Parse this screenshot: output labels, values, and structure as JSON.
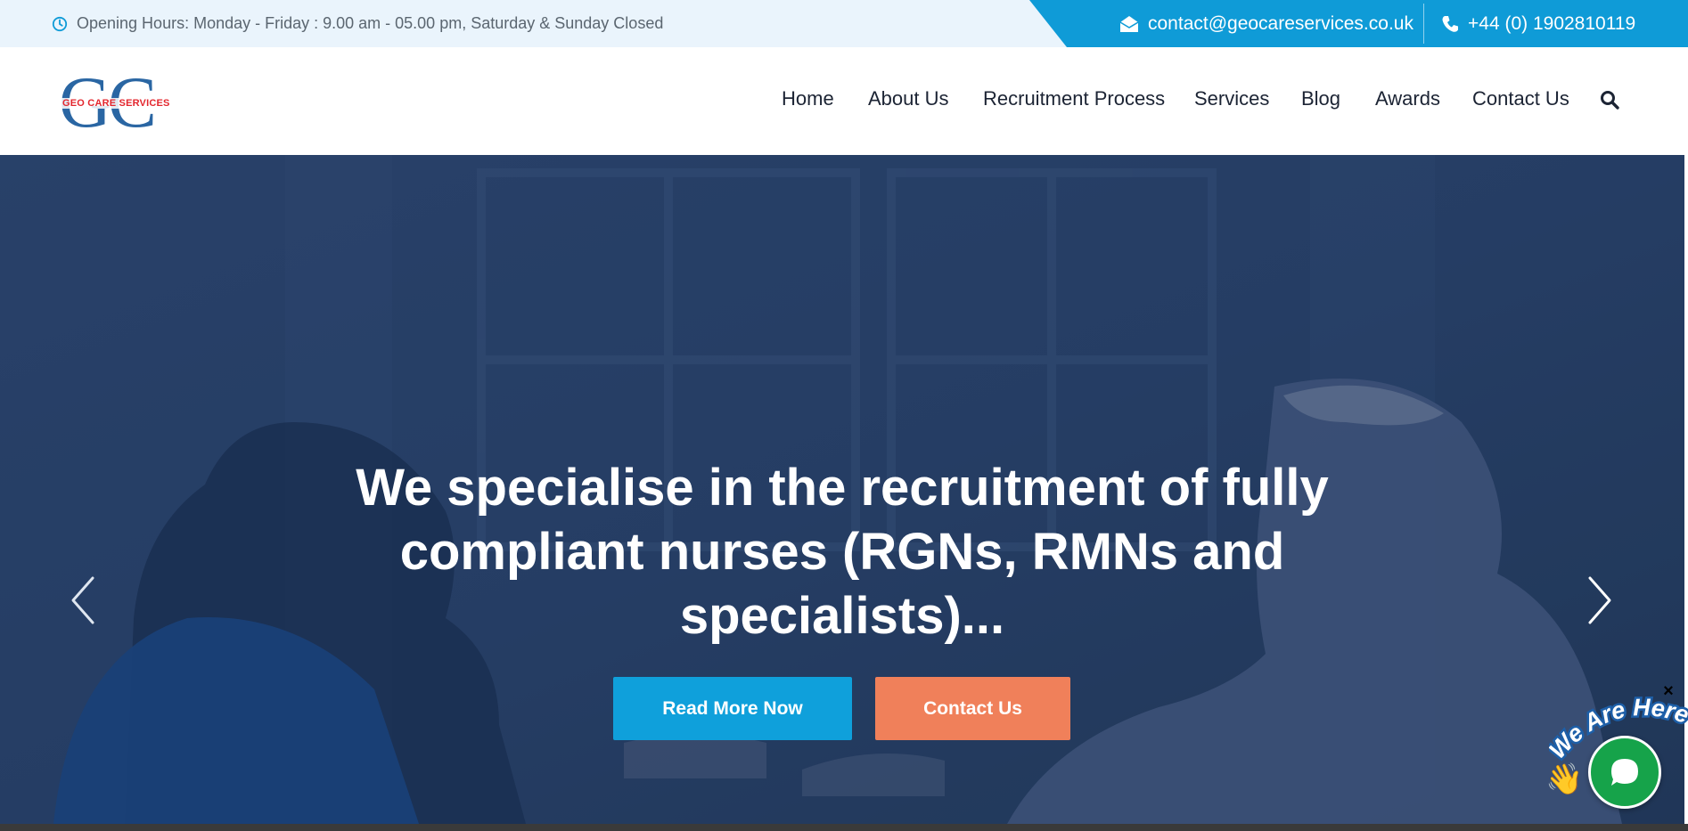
{
  "topbar": {
    "hours": "Opening Hours: Monday - Friday : 9.00 am - 05.00 pm, Saturday & Sunday Closed",
    "email": "contact@geocareservices.co.uk",
    "phone": "+44 (0) 1902810119"
  },
  "logo": {
    "letters": "GC",
    "tagline": "GEO CARE SERVICES"
  },
  "nav": {
    "items": [
      "Home",
      "About Us",
      "Recruitment Process",
      "Services",
      "Blog",
      "Awards",
      "Contact Us"
    ],
    "search_icon": "search-icon"
  },
  "hero": {
    "title": "We specialise in the recruitment of fully compliant nurses (RGNs, RMNs and specialists)...",
    "primary_button": "Read More Now",
    "secondary_button": "Contact Us"
  },
  "chat": {
    "label": "We Are Here!",
    "close": "×"
  },
  "colors": {
    "accent": "#0f9bd7",
    "primary_button": "#0fa0db",
    "secondary_button": "#f0805a",
    "chat": "#16a34a",
    "logo_blue": "#2a66a3",
    "logo_red": "#e3262e"
  }
}
